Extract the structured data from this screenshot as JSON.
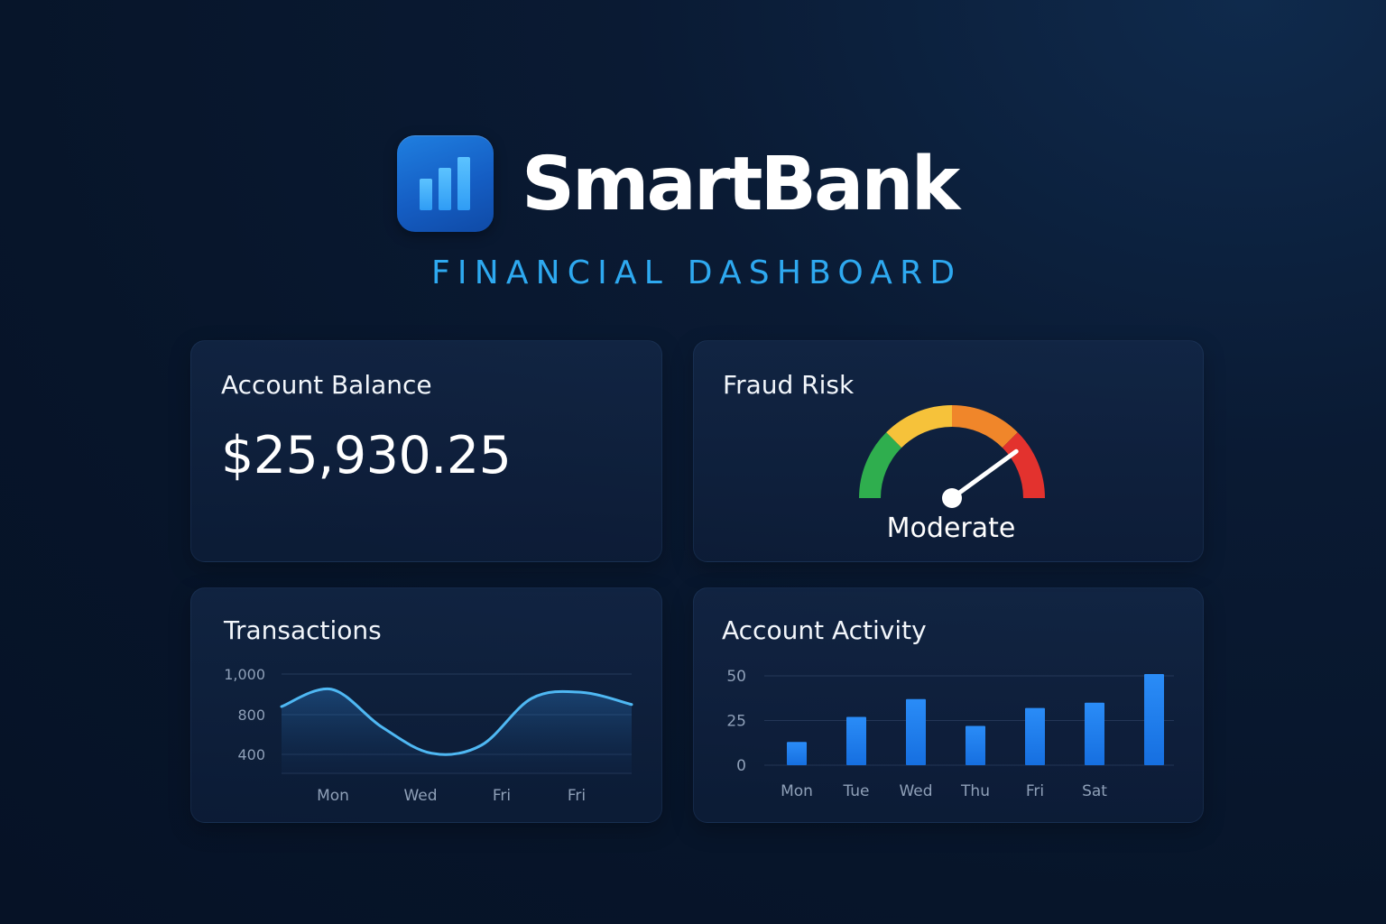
{
  "brand": {
    "name": "SmartBank",
    "subtitle": "FINANCIAL DASHBOARD",
    "logo_icon": "bar-chart-icon",
    "logo_bar_levels": [
      0.45,
      0.7,
      1.0
    ]
  },
  "colors": {
    "background": "#07152a",
    "accent": "#2ea9f0",
    "card": "#11284a",
    "gauge_low": "#2fae4e",
    "gauge_mid_low": "#f6c23a",
    "gauge_mid_high": "#f0862a",
    "gauge_high": "#e3322e",
    "line": "#4fb8f3",
    "bar": "#1f7ef0"
  },
  "balance_card": {
    "title": "Account Balance",
    "value": "$25,930.25"
  },
  "fraud_card": {
    "title": "Fraud Risk",
    "level": "Moderate",
    "gauge_value": 0.8,
    "gauge_segments": [
      "low",
      "mid-low",
      "mid-high",
      "high"
    ],
    "icon": "speedometer-gauge-icon"
  },
  "transactions_card": {
    "title": "Transactions"
  },
  "activity_card": {
    "title": "Account Activity"
  },
  "chart_data": [
    {
      "type": "area",
      "title": "Transactions",
      "xlabel": "",
      "ylabel": "",
      "y_ticks": [
        "1,000",
        "800",
        "400"
      ],
      "x_ticks": [
        "Mon",
        "Wed",
        "Fri",
        "Fri"
      ],
      "grid": true,
      "x": [
        0,
        1,
        2,
        3,
        4,
        5,
        6,
        7
      ],
      "values": [
        840,
        925,
        740,
        610,
        650,
        880,
        910,
        850
      ]
    },
    {
      "type": "bar",
      "title": "Account Activity",
      "xlabel": "",
      "ylabel": "",
      "categories": [
        "Mon",
        "Tue",
        "Wed",
        "Thu",
        "Fri",
        "Sat",
        ""
      ],
      "values": [
        13,
        27,
        37,
        22,
        32,
        35,
        51
      ],
      "y_ticks": [
        "50",
        "25",
        "0"
      ],
      "ylim": [
        0,
        50
      ],
      "grid": true
    }
  ]
}
